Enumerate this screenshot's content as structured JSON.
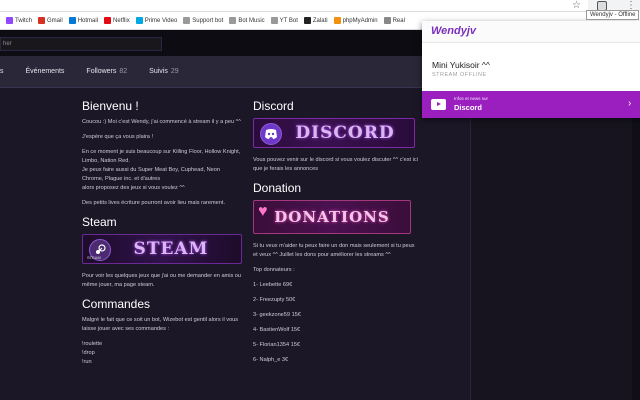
{
  "browser": {
    "tooltip": "Wendyjv - Offline",
    "bookmarks": [
      {
        "label": "Twitch",
        "color": "#9146ff"
      },
      {
        "label": "Gmail",
        "color": "#d93025"
      },
      {
        "label": "Hotmail",
        "color": "#0078d4"
      },
      {
        "label": "Netflix",
        "color": "#e50914"
      },
      {
        "label": "Prime Video",
        "color": "#00a8e1"
      },
      {
        "label": "Support bot",
        "color": "#999999"
      },
      {
        "label": "Bot Music",
        "color": "#999999"
      },
      {
        "label": "YT Bot",
        "color": "#999999"
      },
      {
        "label": "Zalati",
        "color": "#222222"
      },
      {
        "label": "phpMyAdmin",
        "color": "#f29111"
      },
      {
        "label": "Real",
        "color": "#888888"
      }
    ]
  },
  "twitch": {
    "search_placeholder": "her",
    "tabs": {
      "first": "s",
      "events": "Événements",
      "followers_label": "Followers",
      "followers_count": "82",
      "suivis_label": "Suivis",
      "suivis_count": "29"
    },
    "left": {
      "bienvenu_title": "Bienvenu !",
      "bienvenu_p1": "Coucou :) Moi c'est Wendy, j'ai commencé à stream il y a peu ^^",
      "bienvenu_p2": "J'espère que ça vous plaira !",
      "bienvenu_p3": "En ce moment je suis beaucoup sur Killing Floor, Hollow Knight, Limbo, Nation Red.",
      "bienvenu_p4": "Je peux faire aussi du Super Meat Boy, Cuphead, Neon Chrome, Plague inc. et d'autres",
      "bienvenu_p5": "alors proposez des jeux si vous voulez ^^",
      "bienvenu_p6": "Des petits lives écriture pourront avoir lieu mais rarement.",
      "steam_title": "Steam",
      "steam_banner": "STEAM",
      "steam_banner_sub": "STEAM",
      "steam_p": "Pour voir les quelques jeux que j'ai ou me demander en amis ou même jouer, ma page steam.",
      "commandes_title": "Commandes",
      "commandes_p": "Malgré le fait que ce soit un bot, Wizebot est gentil alors il vous laisse jouer avec ses commandes :",
      "commands": [
        "!roulette",
        "!drop",
        "!run"
      ]
    },
    "right": {
      "discord_title": "Discord",
      "discord_banner": "DISCORD",
      "discord_p": "Vous pouvez venir sur le discord si vous voulez discuter ^^ c'est ici que je ferais les annonces",
      "donation_title": "Donation",
      "donation_banner": "DONATIONS",
      "donation_p": "Si tu veux m'aider tu peux faire un don mais seulement si tu peux et veux ^^ Juillet les dons pour améliorer les streams ^^",
      "top_title": "Top donnateurs :",
      "donors": [
        "1- Leebette 69€",
        "2- Freezupty 50€",
        "3- geekzone59 15€",
        "4- BastienWolf 15€",
        "5- Florian1354 15€",
        "6- Nalph_e 3€"
      ]
    }
  },
  "popup": {
    "brand": "Wendyjv",
    "channel_name": "Mini Yukisoir ^^",
    "status": "STREAM OFFLINE",
    "discord_sub": "Infos et news sur",
    "discord_title": "Discord"
  }
}
